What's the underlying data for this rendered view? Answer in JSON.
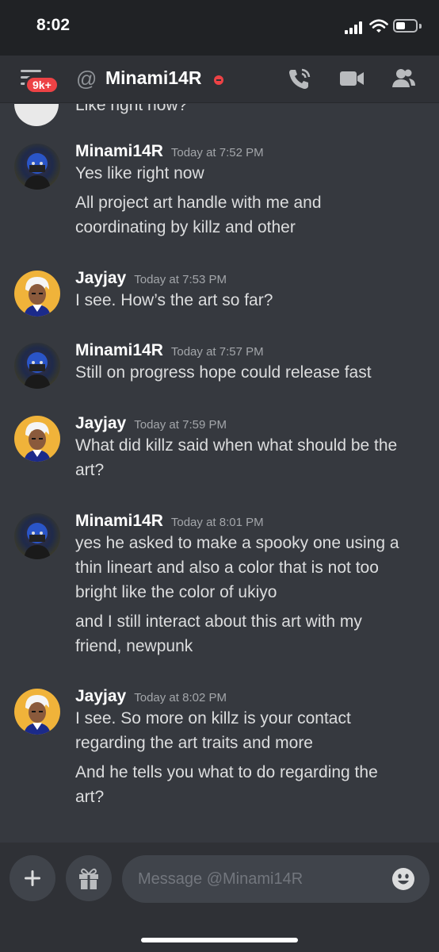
{
  "status_bar": {
    "time": "8:02"
  },
  "header": {
    "badge": "9k+",
    "channel_prefix": "@",
    "channel_name": "Minami14R",
    "icons": [
      "menu-icon",
      "call-icon",
      "video-icon",
      "members-icon"
    ]
  },
  "cutoff_message": "Like right now?",
  "messages": [
    {
      "author": "Minami14R",
      "time": "Today at 7:52 PM",
      "avatar": "avatar-minami",
      "lines": [
        "Yes like right now",
        "All project art handle with me and",
        "coordinating by killz and other"
      ]
    },
    {
      "author": "Jayjay",
      "time": "Today at 7:53 PM",
      "avatar": "avatar-jayjay",
      "lines": [
        "I see. How’s the art so far?"
      ]
    },
    {
      "author": "Minami14R",
      "time": "Today at 7:57 PM",
      "avatar": "avatar-minami",
      "lines": [
        "Still on progress hope could release fast"
      ]
    },
    {
      "author": "Jayjay",
      "time": "Today at 7:59 PM",
      "avatar": "avatar-jayjay",
      "lines": [
        "What did killz said when what should be the",
        "art?"
      ]
    },
    {
      "author": "Minami14R",
      "time": "Today at 8:01 PM",
      "avatar": "avatar-minami",
      "lines": [
        "yes he asked to make a spooky one using a",
        "thin lineart and also a color that is not too",
        "bright like the color of ukiyo",
        "and I still interact about this art with my",
        "friend, newpunk"
      ]
    },
    {
      "author": "Jayjay",
      "time": "Today at 8:02 PM",
      "avatar": "avatar-jayjay",
      "lines": [
        "I see. So more on killz is your contact",
        "regarding the art traits and more",
        "And he tells you what to do regarding the",
        "art?"
      ]
    }
  ],
  "composer": {
    "placeholder": "Message @Minami14R",
    "icons": [
      "plus-icon",
      "gift-icon",
      "emoji-icon"
    ]
  },
  "colors": {
    "background": "#36393f",
    "header": "#2f3136",
    "badge": "#ed4245",
    "jayjay_avatar": "#f0b33a"
  }
}
